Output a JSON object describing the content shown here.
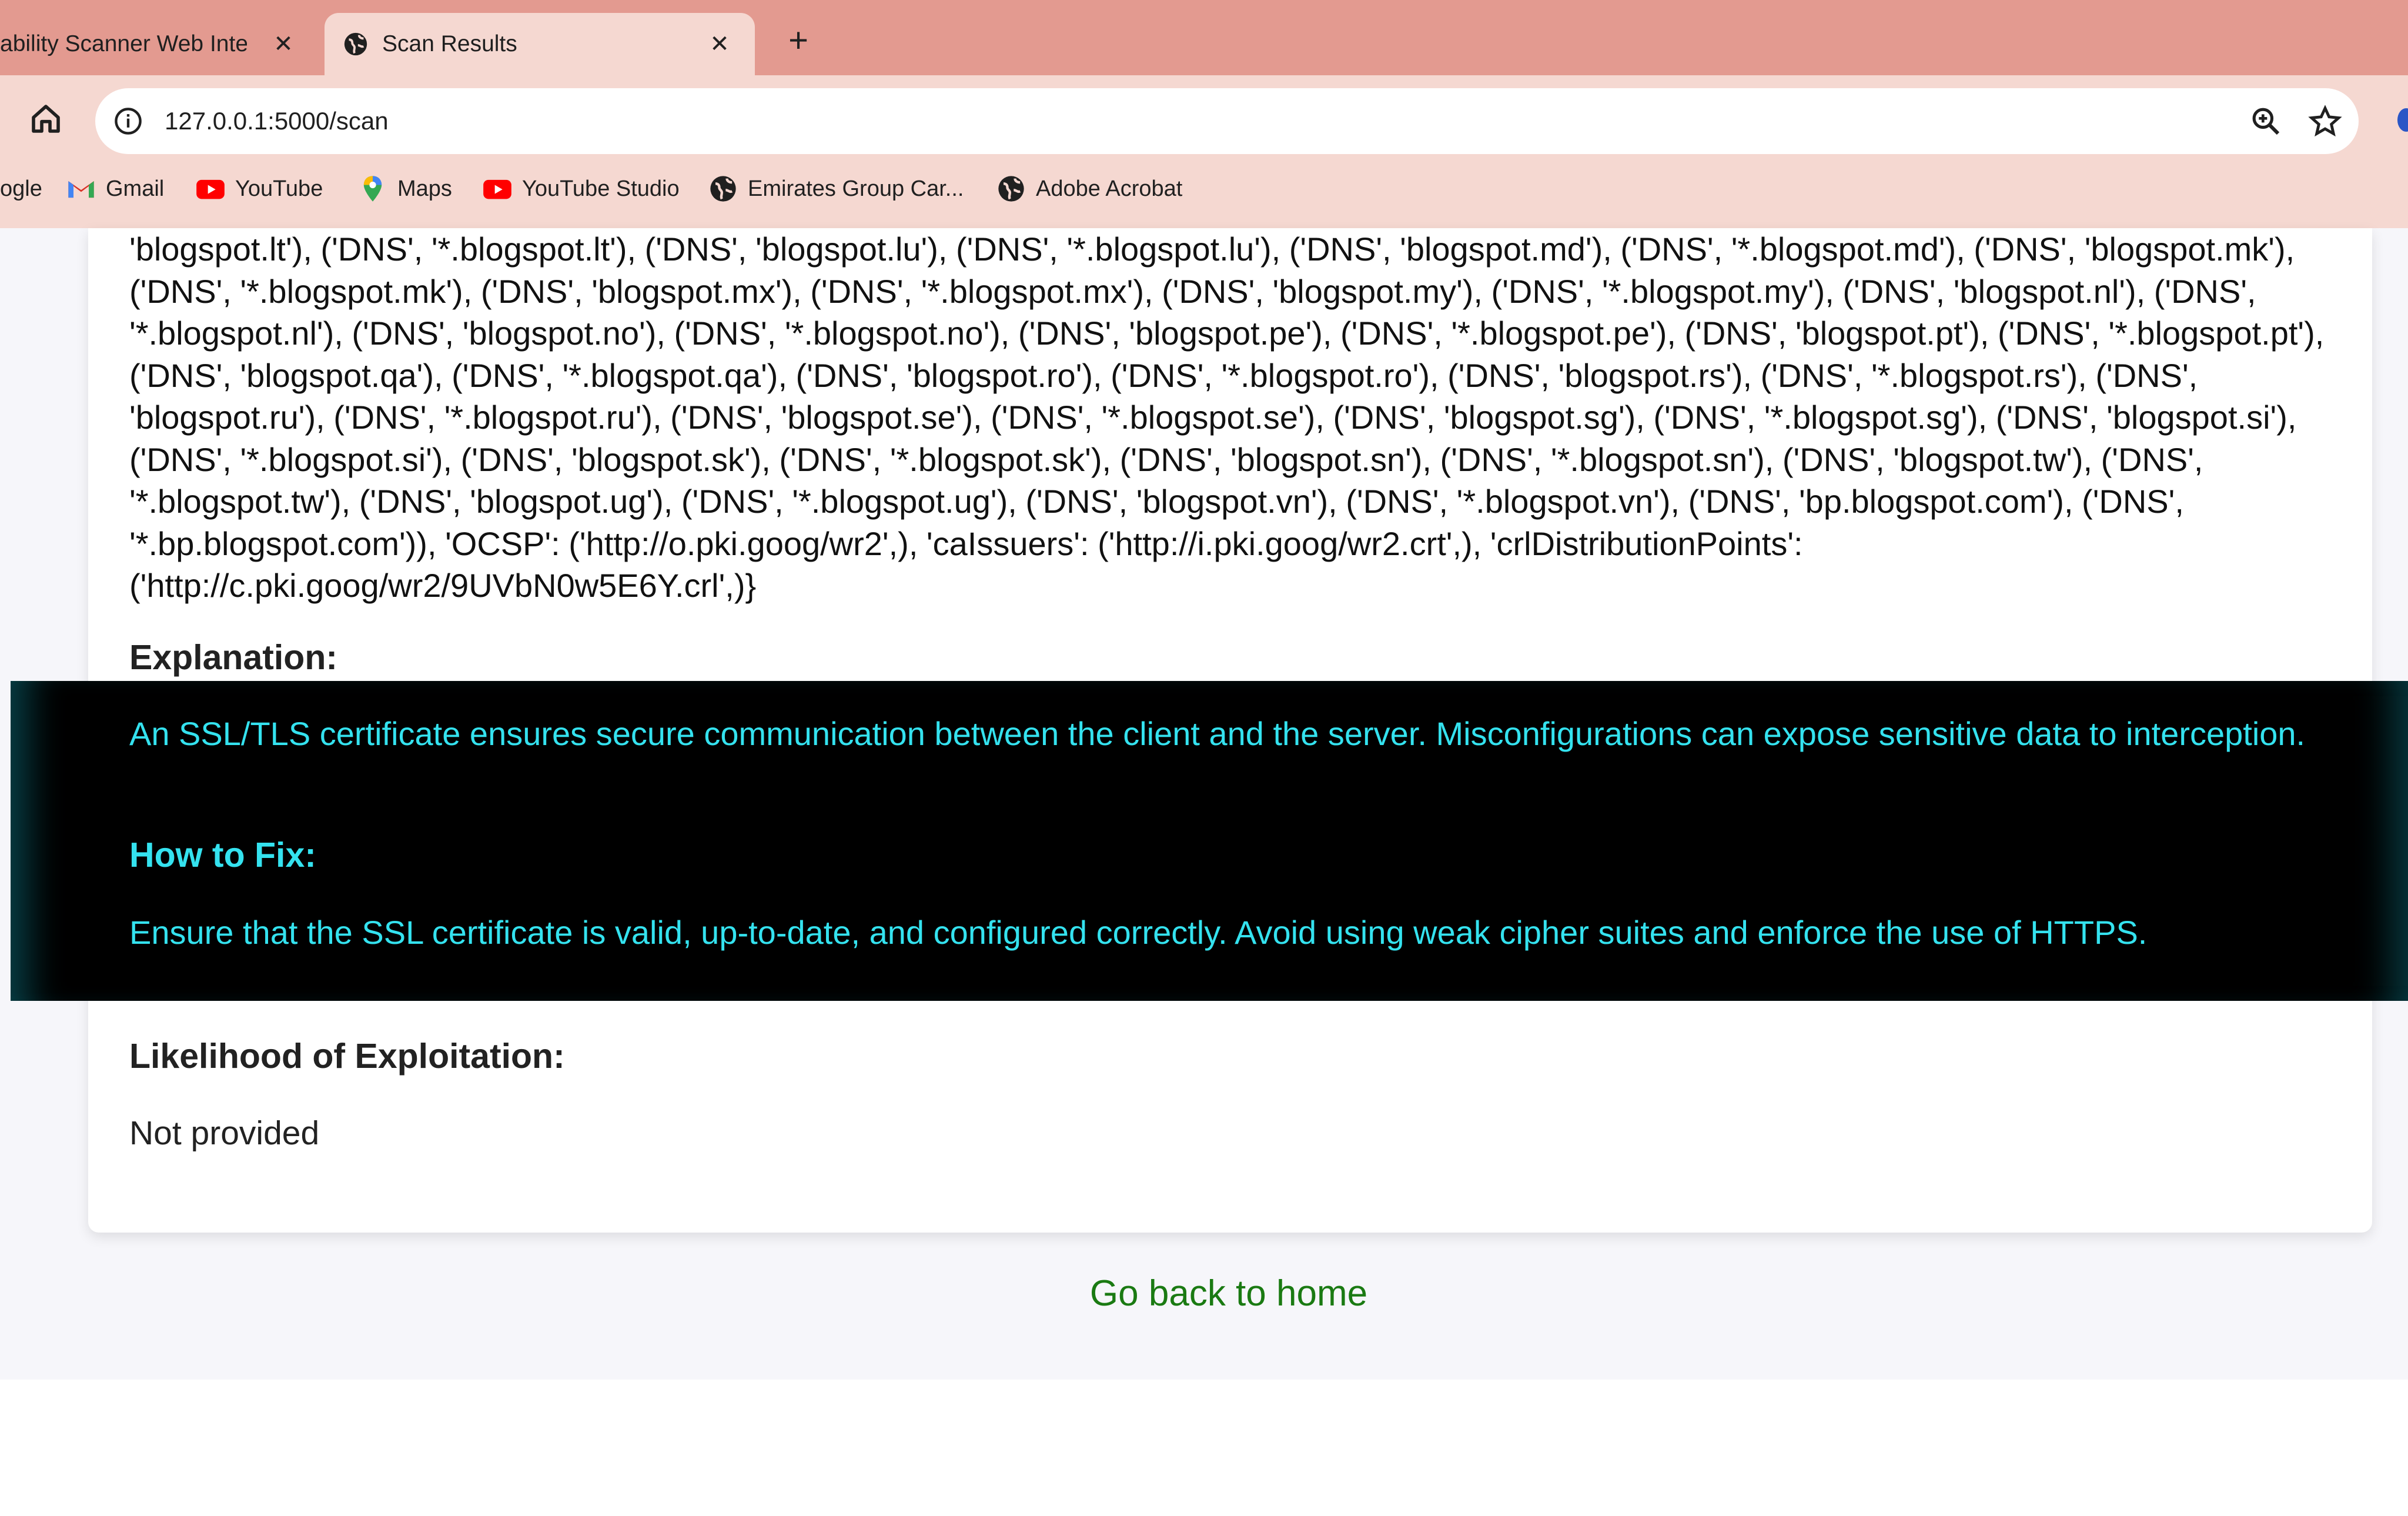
{
  "browser": {
    "tabs": [
      {
        "title": "ability Scanner Web Inte",
        "active": false
      },
      {
        "title": "Scan Results",
        "active": true
      }
    ],
    "new_tab_symbol": "+",
    "close_symbol": "✕",
    "url": "127.0.0.1:5000/scan",
    "bookmarks": [
      {
        "label": "ogle",
        "icon": "google-icon"
      },
      {
        "label": "Gmail",
        "icon": "gmail-icon"
      },
      {
        "label": "YouTube",
        "icon": "youtube-icon"
      },
      {
        "label": "Maps",
        "icon": "maps-icon"
      },
      {
        "label": "YouTube Studio",
        "icon": "youtube-studio-icon"
      },
      {
        "label": "Emirates Group Car...",
        "icon": "globe-icon"
      },
      {
        "label": "Adobe Acrobat",
        "icon": "globe-icon"
      }
    ]
  },
  "result": {
    "certificate_text": "'blogspot.lt'), ('DNS', '*.blogspot.lt'), ('DNS', 'blogspot.lu'), ('DNS', '*.blogspot.lu'), ('DNS', 'blogspot.md'), ('DNS', '*.blogspot.md'), ('DNS', 'blogspot.mk'), ('DNS', '*.blogspot.mk'), ('DNS', 'blogspot.mx'), ('DNS', '*.blogspot.mx'), ('DNS', 'blogspot.my'), ('DNS', '*.blogspot.my'), ('DNS', 'blogspot.nl'), ('DNS', '*.blogspot.nl'), ('DNS', 'blogspot.no'), ('DNS', '*.blogspot.no'), ('DNS', 'blogspot.pe'), ('DNS', '*.blogspot.pe'), ('DNS', 'blogspot.pt'), ('DNS', '*.blogspot.pt'), ('DNS', 'blogspot.qa'), ('DNS', '*.blogspot.qa'), ('DNS', 'blogspot.ro'), ('DNS', '*.blogspot.ro'), ('DNS', 'blogspot.rs'), ('DNS', '*.blogspot.rs'), ('DNS', 'blogspot.ru'), ('DNS', '*.blogspot.ru'), ('DNS', 'blogspot.se'), ('DNS', '*.blogspot.se'), ('DNS', 'blogspot.sg'), ('DNS', '*.blogspot.sg'), ('DNS', 'blogspot.si'), ('DNS', '*.blogspot.si'), ('DNS', 'blogspot.sk'), ('DNS', '*.blogspot.sk'), ('DNS', 'blogspot.sn'), ('DNS', '*.blogspot.sn'), ('DNS', 'blogspot.tw'), ('DNS', '*.blogspot.tw'), ('DNS', 'blogspot.ug'), ('DNS', '*.blogspot.ug'), ('DNS', 'blogspot.vn'), ('DNS', '*.blogspot.vn'), ('DNS', 'bp.blogspot.com'), ('DNS', '*.bp.blogspot.com')), 'OCSP': ('http://o.pki.goog/wr2',), 'caIssuers': ('http://i.pki.goog/wr2.crt',), 'crlDistributionPoints': ('http://c.pki.goog/wr2/9UVbN0w5E6Y.crl',)}",
    "explanation_heading": "Explanation:",
    "explanation_text": "An SSL/TLS certificate ensures secure communication between the client and the server. Misconfigurations can expose sensitive data to interception.",
    "fix_heading": "How to Fix:",
    "fix_text": "Ensure that the SSL certificate is valid, up-to-date, and configured correctly. Avoid using weak cipher suites and enforce the use of HTTPS.",
    "likelihood_heading": "Likelihood of Exploitation:",
    "likelihood_value": "Not provided"
  },
  "back_link": "Go back to home",
  "colors": {
    "tab_strip": "#e39a90",
    "toolbar": "#f5d8d1",
    "highlight_text": "#34e2ef",
    "link": "#1a7a12"
  }
}
